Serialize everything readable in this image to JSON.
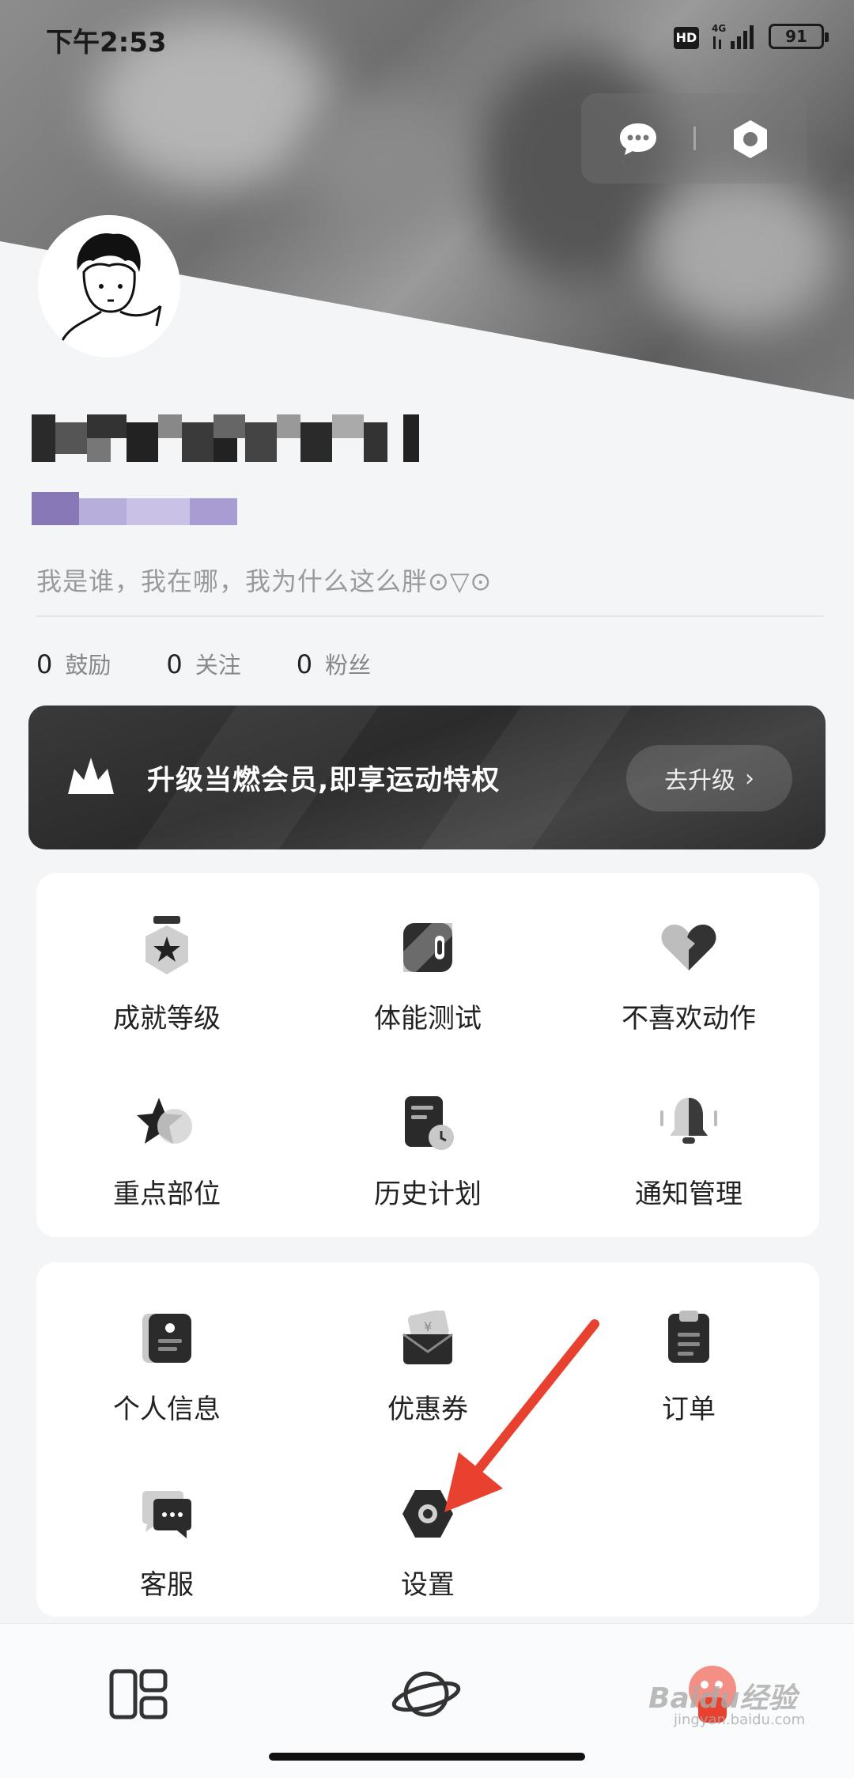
{
  "status_bar": {
    "time": "下午2:53",
    "hd": "HD",
    "network": "4G",
    "battery": "91"
  },
  "header": {
    "message_icon": "chat-bubble-icon",
    "settings_icon": "hex-settings-icon"
  },
  "profile": {
    "bio": "我是谁，我在哪，我为什么这么胖⊙▽⊙",
    "stats": [
      {
        "num": "0",
        "label": "鼓励"
      },
      {
        "num": "0",
        "label": "关注"
      },
      {
        "num": "0",
        "label": "粉丝"
      }
    ]
  },
  "vip": {
    "text": "升级当燃会员,即享运动特权",
    "button": "去升级",
    "chevron": "›"
  },
  "menu_group_1": [
    {
      "label": "成就等级",
      "icon": "medal-icon"
    },
    {
      "label": "体能测试",
      "icon": "fitness-test-icon"
    },
    {
      "label": "不喜欢动作",
      "icon": "broken-heart-icon"
    },
    {
      "label": "重点部位",
      "icon": "star-icon"
    },
    {
      "label": "历史计划",
      "icon": "history-plan-icon"
    },
    {
      "label": "通知管理",
      "icon": "bell-icon"
    }
  ],
  "menu_group_2": [
    {
      "label": "个人信息",
      "icon": "id-card-icon"
    },
    {
      "label": "优惠券",
      "icon": "coupon-icon"
    },
    {
      "label": "订单",
      "icon": "order-icon"
    },
    {
      "label": "客服",
      "icon": "customer-service-icon"
    },
    {
      "label": "设置",
      "icon": "settings-icon"
    }
  ],
  "bottom_nav": [
    {
      "icon": "layout-icon"
    },
    {
      "icon": "planet-icon"
    },
    {
      "icon": "profile-avatar-icon"
    }
  ],
  "watermark": {
    "main": "Baidu经验",
    "sub": "jingyan.baidu.com"
  },
  "colors": {
    "accent_red": "#e8412f",
    "vip_bg": "#2f2f2f"
  }
}
